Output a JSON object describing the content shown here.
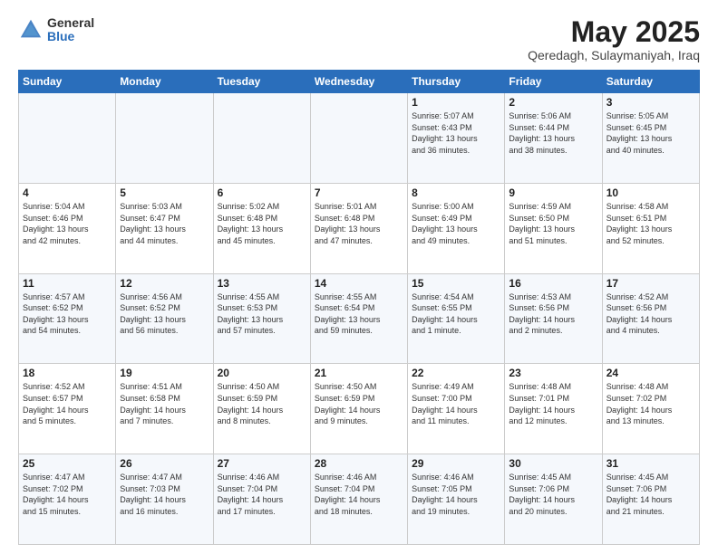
{
  "logo": {
    "general": "General",
    "blue": "Blue"
  },
  "title": "May 2025",
  "location": "Qeredagh, Sulaymaniyah, Iraq",
  "days_header": [
    "Sunday",
    "Monday",
    "Tuesday",
    "Wednesday",
    "Thursday",
    "Friday",
    "Saturday"
  ],
  "weeks": [
    [
      {
        "day": "",
        "info": ""
      },
      {
        "day": "",
        "info": ""
      },
      {
        "day": "",
        "info": ""
      },
      {
        "day": "",
        "info": ""
      },
      {
        "day": "1",
        "info": "Sunrise: 5:07 AM\nSunset: 6:43 PM\nDaylight: 13 hours\nand 36 minutes."
      },
      {
        "day": "2",
        "info": "Sunrise: 5:06 AM\nSunset: 6:44 PM\nDaylight: 13 hours\nand 38 minutes."
      },
      {
        "day": "3",
        "info": "Sunrise: 5:05 AM\nSunset: 6:45 PM\nDaylight: 13 hours\nand 40 minutes."
      }
    ],
    [
      {
        "day": "4",
        "info": "Sunrise: 5:04 AM\nSunset: 6:46 PM\nDaylight: 13 hours\nand 42 minutes."
      },
      {
        "day": "5",
        "info": "Sunrise: 5:03 AM\nSunset: 6:47 PM\nDaylight: 13 hours\nand 44 minutes."
      },
      {
        "day": "6",
        "info": "Sunrise: 5:02 AM\nSunset: 6:48 PM\nDaylight: 13 hours\nand 45 minutes."
      },
      {
        "day": "7",
        "info": "Sunrise: 5:01 AM\nSunset: 6:48 PM\nDaylight: 13 hours\nand 47 minutes."
      },
      {
        "day": "8",
        "info": "Sunrise: 5:00 AM\nSunset: 6:49 PM\nDaylight: 13 hours\nand 49 minutes."
      },
      {
        "day": "9",
        "info": "Sunrise: 4:59 AM\nSunset: 6:50 PM\nDaylight: 13 hours\nand 51 minutes."
      },
      {
        "day": "10",
        "info": "Sunrise: 4:58 AM\nSunset: 6:51 PM\nDaylight: 13 hours\nand 52 minutes."
      }
    ],
    [
      {
        "day": "11",
        "info": "Sunrise: 4:57 AM\nSunset: 6:52 PM\nDaylight: 13 hours\nand 54 minutes."
      },
      {
        "day": "12",
        "info": "Sunrise: 4:56 AM\nSunset: 6:52 PM\nDaylight: 13 hours\nand 56 minutes."
      },
      {
        "day": "13",
        "info": "Sunrise: 4:55 AM\nSunset: 6:53 PM\nDaylight: 13 hours\nand 57 minutes."
      },
      {
        "day": "14",
        "info": "Sunrise: 4:55 AM\nSunset: 6:54 PM\nDaylight: 13 hours\nand 59 minutes."
      },
      {
        "day": "15",
        "info": "Sunrise: 4:54 AM\nSunset: 6:55 PM\nDaylight: 14 hours\nand 1 minute."
      },
      {
        "day": "16",
        "info": "Sunrise: 4:53 AM\nSunset: 6:56 PM\nDaylight: 14 hours\nand 2 minutes."
      },
      {
        "day": "17",
        "info": "Sunrise: 4:52 AM\nSunset: 6:56 PM\nDaylight: 14 hours\nand 4 minutes."
      }
    ],
    [
      {
        "day": "18",
        "info": "Sunrise: 4:52 AM\nSunset: 6:57 PM\nDaylight: 14 hours\nand 5 minutes."
      },
      {
        "day": "19",
        "info": "Sunrise: 4:51 AM\nSunset: 6:58 PM\nDaylight: 14 hours\nand 7 minutes."
      },
      {
        "day": "20",
        "info": "Sunrise: 4:50 AM\nSunset: 6:59 PM\nDaylight: 14 hours\nand 8 minutes."
      },
      {
        "day": "21",
        "info": "Sunrise: 4:50 AM\nSunset: 6:59 PM\nDaylight: 14 hours\nand 9 minutes."
      },
      {
        "day": "22",
        "info": "Sunrise: 4:49 AM\nSunset: 7:00 PM\nDaylight: 14 hours\nand 11 minutes."
      },
      {
        "day": "23",
        "info": "Sunrise: 4:48 AM\nSunset: 7:01 PM\nDaylight: 14 hours\nand 12 minutes."
      },
      {
        "day": "24",
        "info": "Sunrise: 4:48 AM\nSunset: 7:02 PM\nDaylight: 14 hours\nand 13 minutes."
      }
    ],
    [
      {
        "day": "25",
        "info": "Sunrise: 4:47 AM\nSunset: 7:02 PM\nDaylight: 14 hours\nand 15 minutes."
      },
      {
        "day": "26",
        "info": "Sunrise: 4:47 AM\nSunset: 7:03 PM\nDaylight: 14 hours\nand 16 minutes."
      },
      {
        "day": "27",
        "info": "Sunrise: 4:46 AM\nSunset: 7:04 PM\nDaylight: 14 hours\nand 17 minutes."
      },
      {
        "day": "28",
        "info": "Sunrise: 4:46 AM\nSunset: 7:04 PM\nDaylight: 14 hours\nand 18 minutes."
      },
      {
        "day": "29",
        "info": "Sunrise: 4:46 AM\nSunset: 7:05 PM\nDaylight: 14 hours\nand 19 minutes."
      },
      {
        "day": "30",
        "info": "Sunrise: 4:45 AM\nSunset: 7:06 PM\nDaylight: 14 hours\nand 20 minutes."
      },
      {
        "day": "31",
        "info": "Sunrise: 4:45 AM\nSunset: 7:06 PM\nDaylight: 14 hours\nand 21 minutes."
      }
    ]
  ]
}
